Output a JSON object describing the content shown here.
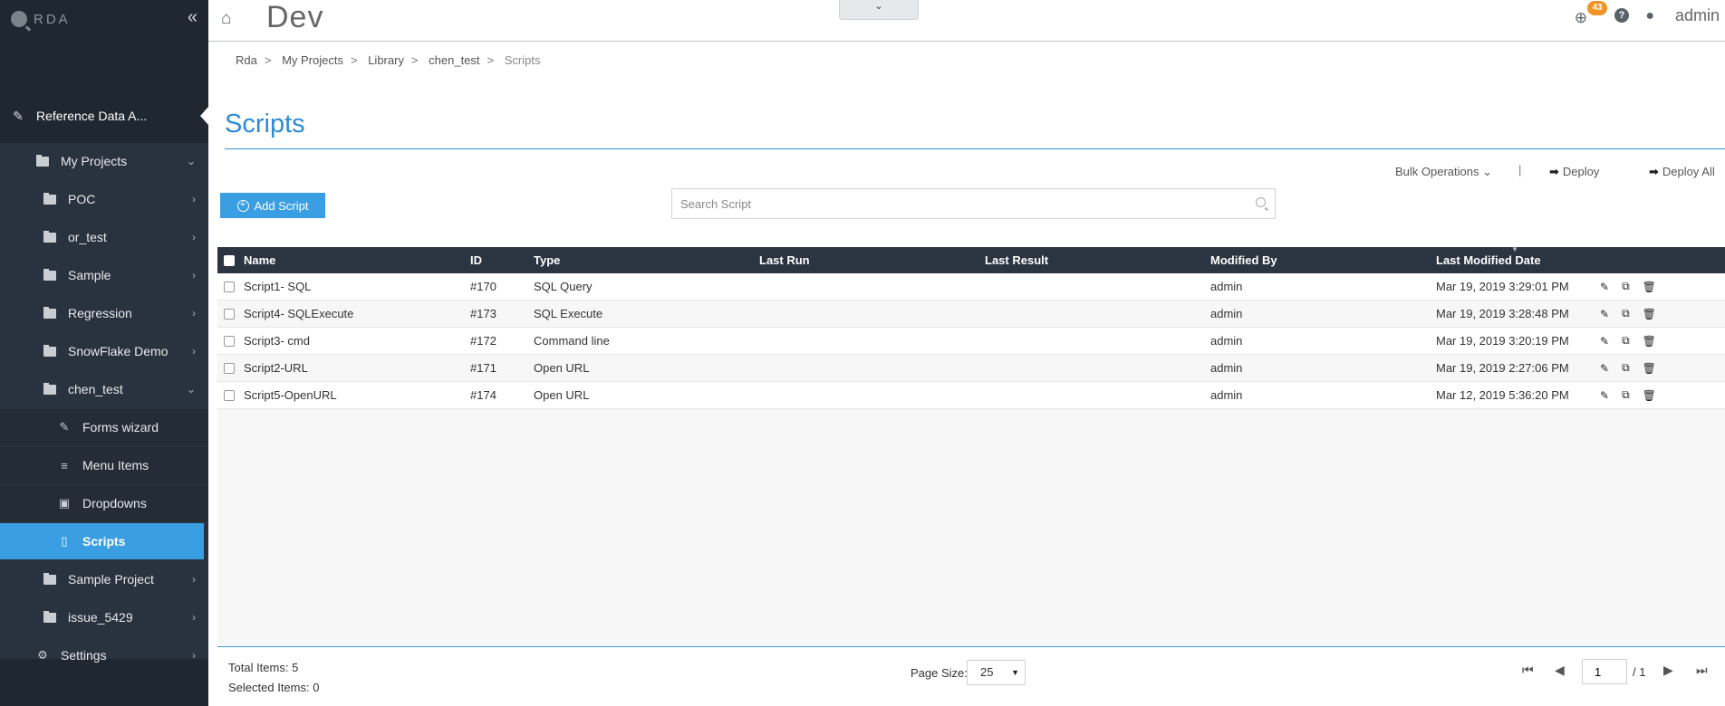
{
  "app": {
    "logo_text": "RDA",
    "env_title": "Dev",
    "user": "admin",
    "notification_count": "43"
  },
  "sidebar": {
    "section_title": "Reference Data A...",
    "items": [
      {
        "label": "My Projects",
        "chevron": "expanded"
      },
      {
        "label": "POC"
      },
      {
        "label": "or_test"
      },
      {
        "label": "Sample"
      },
      {
        "label": "Regression"
      },
      {
        "label": "SnowFlake Demo"
      },
      {
        "label": "chen_test",
        "chevron": "expanded"
      },
      {
        "label": "Forms wizard",
        "icon": "wand-icon"
      },
      {
        "label": "Menu Items",
        "icon": "list-icon"
      },
      {
        "label": "Dropdowns",
        "icon": "dropdown-icon"
      },
      {
        "label": "Scripts",
        "icon": "file-icon",
        "active": true
      },
      {
        "label": "Sample Project"
      },
      {
        "label": "issue_5429"
      },
      {
        "label": "Settings",
        "icon": "gear-icon"
      }
    ]
  },
  "breadcrumb": [
    "Rda",
    "My Projects",
    "Library",
    "chen_test",
    "Scripts"
  ],
  "page": {
    "title": "Scripts"
  },
  "toolbar": {
    "bulk_operations": "Bulk Operations",
    "separator": "|",
    "deploy": "Deploy",
    "deploy_all": "Deploy All",
    "add_script": "Add Script",
    "search_placeholder": "Search Script"
  },
  "table": {
    "columns": [
      "Name",
      "ID",
      "Type",
      "Last Run",
      "Last Result",
      "Modified By",
      "Last Modified Date"
    ],
    "rows": [
      {
        "name": "Script1- SQL",
        "id": "#170",
        "type": "SQL Query",
        "last_run": "",
        "last_result": "",
        "modified_by": "admin",
        "date": "Mar 19, 2019 3:29:01 PM"
      },
      {
        "name": "Script4- SQLExecute",
        "id": "#173",
        "type": "SQL Execute",
        "last_run": "",
        "last_result": "",
        "modified_by": "admin",
        "date": "Mar 19, 2019 3:28:48 PM"
      },
      {
        "name": "Script3- cmd",
        "id": "#172",
        "type": "Command line",
        "last_run": "",
        "last_result": "",
        "modified_by": "admin",
        "date": "Mar 19, 2019 3:20:19 PM"
      },
      {
        "name": "Script2-URL",
        "id": "#171",
        "type": "Open URL",
        "last_run": "",
        "last_result": "",
        "modified_by": "admin",
        "date": "Mar 19, 2019 2:27:06 PM"
      },
      {
        "name": "Script5-OpenURL",
        "id": "#174",
        "type": "Open URL",
        "last_run": "",
        "last_result": "",
        "modified_by": "admin",
        "date": "Mar 12, 2019 5:36:20 PM"
      }
    ]
  },
  "footer": {
    "total_items": "Total Items: 5",
    "selected_items": "Selected Items: 0",
    "page_size_label": "Page Size:",
    "page_size": "25",
    "current_page": "1",
    "page_of": "/ 1"
  },
  "colors": {
    "accent": "#3a9ee3",
    "sidebar_bg": "#29333f",
    "header_bg": "#2b3441",
    "badge": "#f29324"
  }
}
